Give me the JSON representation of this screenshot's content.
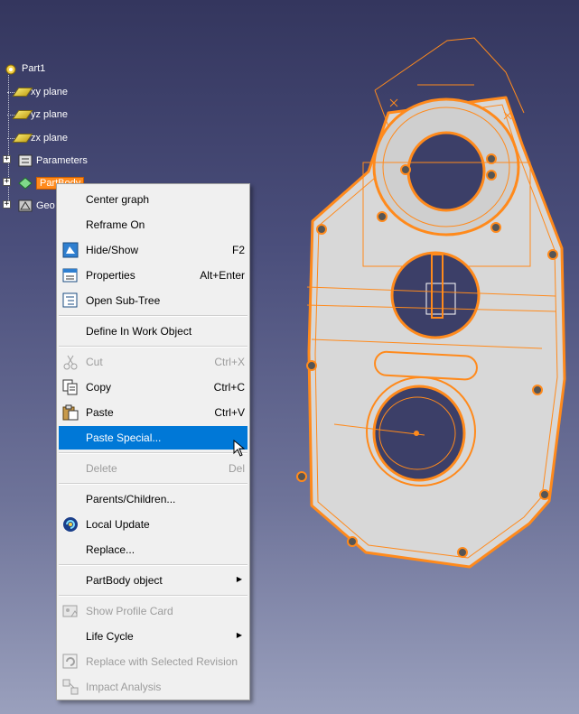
{
  "tree": {
    "root": "Part1",
    "items": [
      {
        "label": "xy plane"
      },
      {
        "label": "yz plane"
      },
      {
        "label": "zx plane"
      },
      {
        "label": "Parameters"
      },
      {
        "label": "PartBody"
      },
      {
        "label": "Geo"
      }
    ]
  },
  "menu": {
    "items": [
      {
        "label": "Center graph",
        "shortcut": ""
      },
      {
        "label": "Reframe On",
        "shortcut": ""
      },
      {
        "label": "Hide/Show",
        "shortcut": "F2"
      },
      {
        "label": "Properties",
        "shortcut": "Alt+Enter"
      },
      {
        "label": "Open Sub-Tree",
        "shortcut": ""
      },
      {
        "label": "Define In Work Object",
        "shortcut": ""
      },
      {
        "label": "Cut",
        "shortcut": "Ctrl+X"
      },
      {
        "label": "Copy",
        "shortcut": "Ctrl+C"
      },
      {
        "label": "Paste",
        "shortcut": "Ctrl+V"
      },
      {
        "label": "Paste Special...",
        "shortcut": ""
      },
      {
        "label": "Delete",
        "shortcut": "Del"
      },
      {
        "label": "Parents/Children...",
        "shortcut": ""
      },
      {
        "label": "Local Update",
        "shortcut": ""
      },
      {
        "label": "Replace...",
        "shortcut": ""
      },
      {
        "label": "PartBody object",
        "shortcut": ""
      },
      {
        "label": "Show Profile Card",
        "shortcut": ""
      },
      {
        "label": "Life Cycle",
        "shortcut": ""
      },
      {
        "label": "Replace with Selected Revision",
        "shortcut": ""
      },
      {
        "label": "Impact Analysis",
        "shortcut": ""
      }
    ]
  },
  "colors": {
    "selection": "#0078d7",
    "geometry_highlight": "#ff8a1c",
    "part_fill": "#d9d9d9"
  }
}
